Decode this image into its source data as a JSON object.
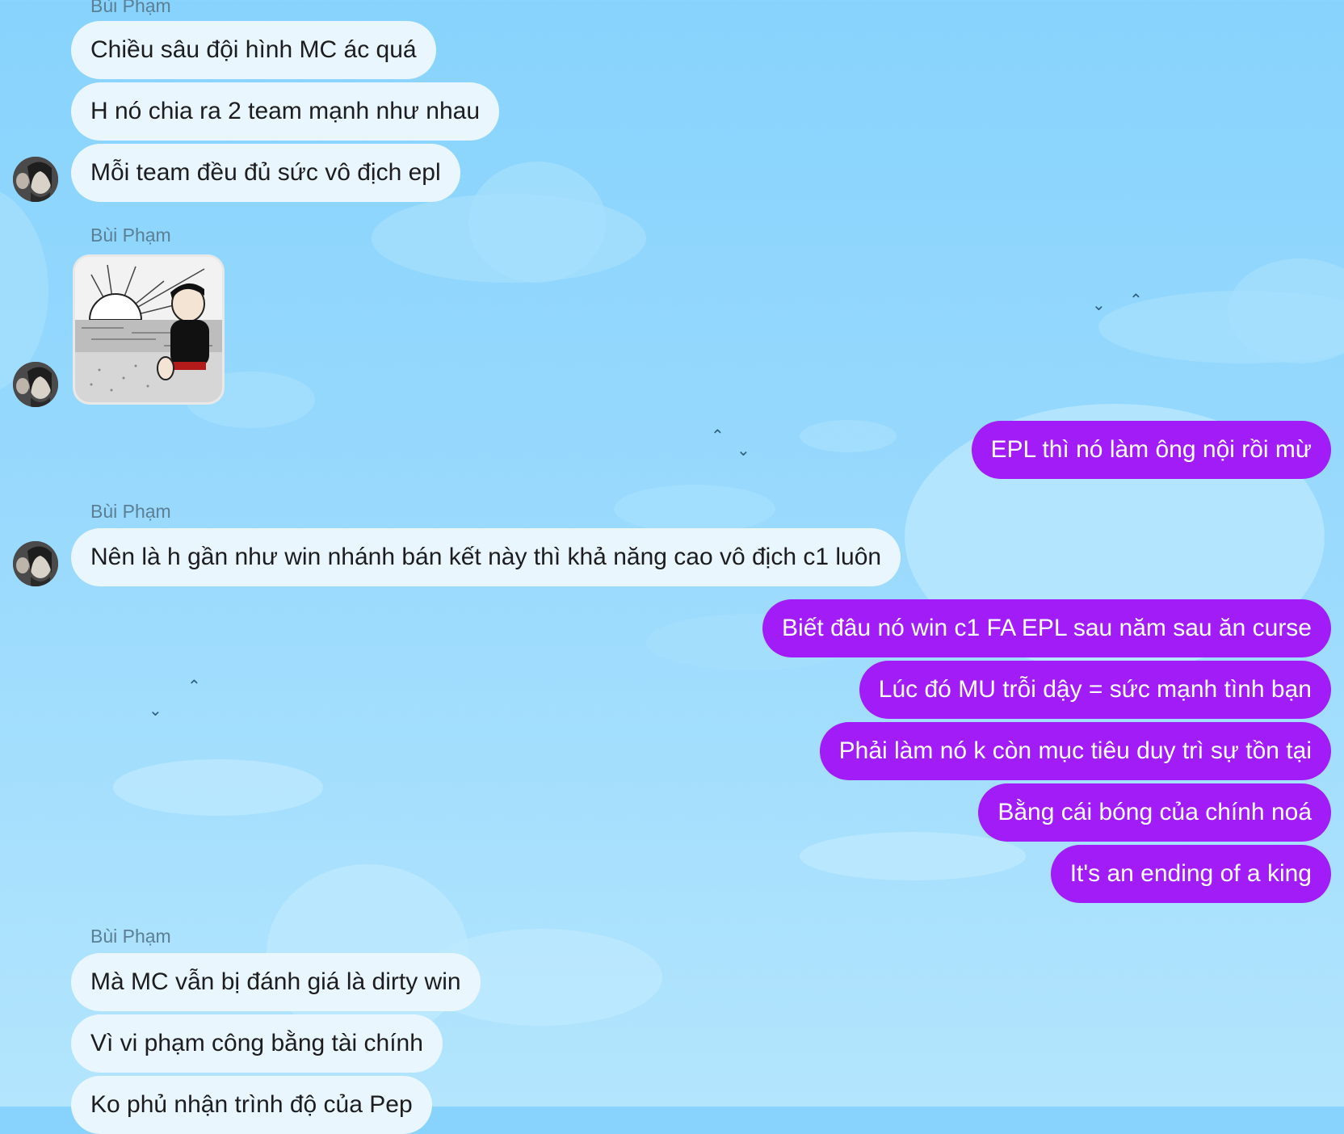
{
  "sender_name": "Bùi Phạm",
  "sticker_icon": "sunset-beach-sticker",
  "avatar_icon": "contact-avatar",
  "colors": {
    "incoming_bubble": "#e9f6fd",
    "outgoing_bubble": "#a11cf7"
  },
  "groups": [
    {
      "sender": "Bùi Phạm",
      "messages": [
        "Chiều sâu đội hình MC ác quá",
        "H nó chia ra 2 team mạnh như nhau",
        "Mỗi team đều đủ sức vô địch epl"
      ]
    },
    {
      "sender": "Bùi Phạm",
      "messages": []
    },
    {
      "sender": "Bùi Phạm",
      "messages": [
        "Nên là h gần như win nhánh bán kết này thì khả năng cao vô địch c1 luôn"
      ]
    },
    {
      "sender": "Bùi Phạm",
      "messages": [
        "Mà MC vẫn bị đánh giá là dirty win",
        "Vì vi phạm công bằng tài chính",
        "Ko phủ nhận trình độ của Pep"
      ]
    }
  ],
  "outgoing": [
    "EPL thì nó làm ông nội rồi mừ",
    "Biết đâu nó win c1 FA EPL sau năm sau ăn curse",
    "Lúc đó MU trỗi dậy = sức mạnh tình bạn",
    "Phải làm nó k còn mục tiêu duy trì sự tồn tại",
    "Bằng cái bóng của chính noá",
    "It's an ending of a king"
  ]
}
